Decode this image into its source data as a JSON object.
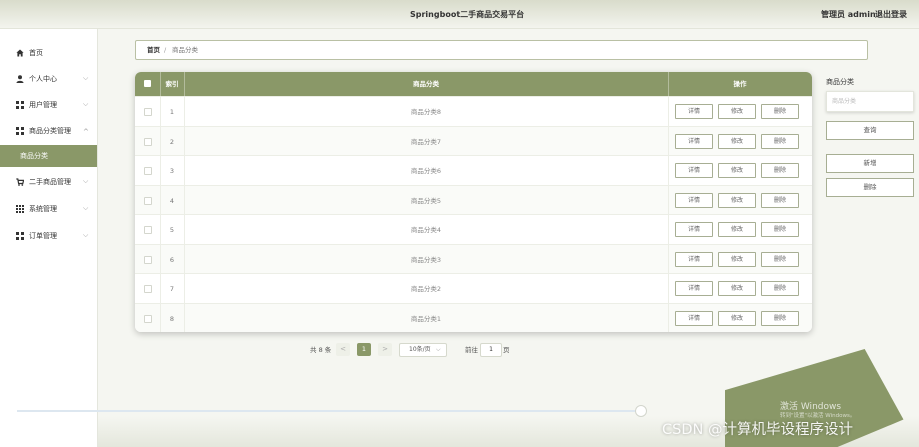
{
  "header": {
    "app_title": "Springboot二手商品交易平台",
    "user_label": "管理员 admin",
    "logout": "退出登录"
  },
  "sidebar": {
    "items": [
      {
        "label": "首页",
        "icon": "home-icon"
      },
      {
        "label": "个人中心",
        "icon": "user-icon",
        "expandable": true
      },
      {
        "label": "用户管理",
        "icon": "grid-icon",
        "expandable": true
      },
      {
        "label": "商品分类管理",
        "icon": "grid-icon",
        "expandable": true,
        "expanded": true
      },
      {
        "label": "二手商品管理",
        "icon": "cart-icon",
        "expandable": true
      },
      {
        "label": "系统管理",
        "icon": "grid9-icon",
        "expandable": true
      },
      {
        "label": "订单管理",
        "icon": "grid-icon",
        "expandable": true
      }
    ],
    "submenu_active": "商品分类"
  },
  "breadcrumb": {
    "home": "首页",
    "separator": "/",
    "current": "商品分类"
  },
  "table": {
    "headers": {
      "index": "索引",
      "category": "商品分类",
      "actions": "操作"
    },
    "rows": [
      {
        "index": "1",
        "category": "商品分类8"
      },
      {
        "index": "2",
        "category": "商品分类7"
      },
      {
        "index": "3",
        "category": "商品分类6"
      },
      {
        "index": "4",
        "category": "商品分类5"
      },
      {
        "index": "5",
        "category": "商品分类4"
      },
      {
        "index": "6",
        "category": "商品分类3"
      },
      {
        "index": "7",
        "category": "商品分类2"
      },
      {
        "index": "8",
        "category": "商品分类1"
      }
    ],
    "row_actions": {
      "detail": "详情",
      "edit": "修改",
      "delete": "删除"
    }
  },
  "pagination": {
    "total": "共 8 条",
    "prev": "<",
    "current_page": "1",
    "next": ">",
    "page_size": "10条/页",
    "page_size_chevron": "⌵",
    "goto_label": "前往",
    "goto_value": "1",
    "page_unit": "页"
  },
  "right_panel": {
    "title": "商品分类",
    "search_placeholder": "商品分类",
    "query_button": "查询",
    "add_button": "新增",
    "delete_button": "删除"
  },
  "overlay": {
    "windows_title": "激活 Windows",
    "windows_sub": "转到\"设置\"以激活 Windows。",
    "watermark": "CSDN @计算机毕设程序设计"
  },
  "colors": {
    "accent": "#8a9868",
    "button_border": "#a7ae93"
  }
}
